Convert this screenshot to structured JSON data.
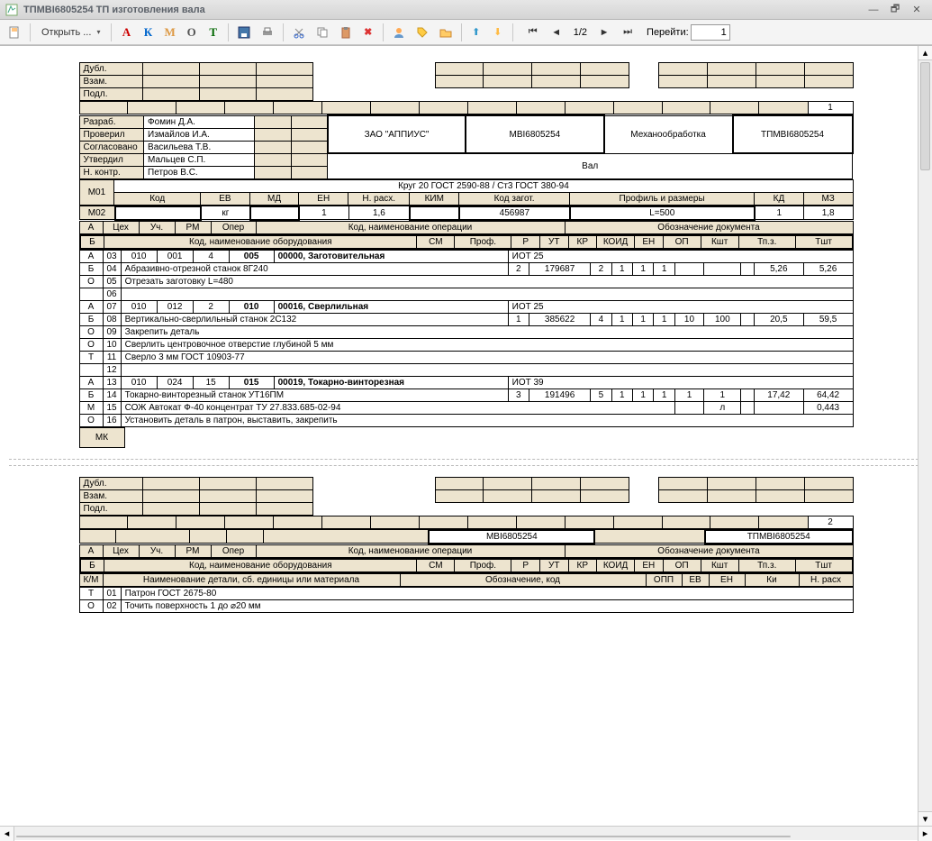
{
  "window": {
    "title": "ТПМВІ6805254 ТП изготовления вала"
  },
  "toolbar": {
    "open_label": "Открыть ...",
    "letters": [
      "А",
      "К",
      "М",
      "О",
      "Т"
    ],
    "page_indicator": "1/2",
    "goto_label": "Перейти:",
    "goto_value": "1"
  },
  "page1": {
    "stubs": [
      "Дубл.",
      "Взам.",
      "Подл."
    ],
    "page_no": "1",
    "signers": [
      {
        "role": "Разраб.",
        "name": "Фомин Д.А."
      },
      {
        "role": "Проверил",
        "name": "Измайлов И.А."
      },
      {
        "role": "Согласовано",
        "name": "Васильева Т.В."
      },
      {
        "role": "Утвердил",
        "name": "Мальцев С.П."
      },
      {
        "role": "Н. контр.",
        "name": "Петров В.С."
      }
    ],
    "company": "ЗАО \"АППИУС\"",
    "code1": "МВІ6805254",
    "proc": "Механообработка",
    "code2": "ТПМВІ6805254",
    "part_name": "Вал",
    "material": "Круг 20  ГОСТ 2590-88 / Ст3  ГОСТ 380-94",
    "m01": "М01",
    "m02": "М02",
    "hdr1": {
      "kod": "Код",
      "ev": "ЕВ",
      "md": "МД",
      "en": "ЕН",
      "nrash": "Н. расх.",
      "kim": "КИМ",
      "kodz": "Код загот.",
      "prof": "Профиль и размеры",
      "kd": "КД",
      "mz": "МЗ"
    },
    "vals1": {
      "ev": "кг",
      "en": "1",
      "nrash": "1,6",
      "kodz": "456987",
      "prof": "L=500",
      "kd": "1",
      "mz": "1,8"
    },
    "ophdr": {
      "a": "А",
      "ceh": "Цех",
      "uch": "Уч.",
      "rm": "РМ",
      "oper": "Опер",
      "opname": "Код, наименование операции",
      "doc": "Обозначение документа"
    },
    "bhdr": {
      "b": "Б",
      "equip": "Код, наименование оборудования",
      "sm": "СМ",
      "prof": "Проф.",
      "r": "Р",
      "ut": "УТ",
      "kr": "КР",
      "koid": "КОИД",
      "en": "ЕН",
      "op": "ОП",
      "ksht": "Кшт",
      "tpz": "Тп.з.",
      "tsht": "Тшт"
    },
    "rows": [
      {
        "m": "А",
        "n": "03",
        "ceh": "010",
        "uch": "001",
        "rm": "4",
        "oper": "005",
        "name": "00000, Заготовительная",
        "doc": "ИОТ 25"
      },
      {
        "m": "Б",
        "n": "04",
        "text": "Абразивно-отрезной станок 8Г240",
        "sm": "2",
        "prof": "179687",
        "r": "2",
        "ut": "1",
        "kr": "1",
        "koid": "1",
        "tpz": "5,26",
        "tsht": "5,26"
      },
      {
        "m": "О",
        "n": "05",
        "text": "Отрезать заготовку L=480"
      },
      {
        "m": "",
        "n": "06"
      },
      {
        "m": "А",
        "n": "07",
        "ceh": "010",
        "uch": "012",
        "rm": "2",
        "oper": "010",
        "name": "00016, Сверлильная",
        "doc": "ИОТ 25"
      },
      {
        "m": "Б",
        "n": "08",
        "text": "Вертикально-сверлильный станок 2С132",
        "sm": "1",
        "prof": "385622",
        "r": "4",
        "ut": "1",
        "kr": "1",
        "koid": "1",
        "en": "10",
        "op": "100",
        "tpz": "20,5",
        "tsht": "59,5"
      },
      {
        "m": "О",
        "n": "09",
        "text": "Закрепить деталь"
      },
      {
        "m": "О",
        "n": "10",
        "text": "Сверлить  центровочное отверстие  глубиной 5 мм"
      },
      {
        "m": "Т",
        "n": "11",
        "text": "Сверло 3 мм   ГОСТ 10903-77"
      },
      {
        "m": "",
        "n": "12"
      },
      {
        "m": "А",
        "n": "13",
        "ceh": "010",
        "uch": "024",
        "rm": "15",
        "oper": "015",
        "name": "00019, Токарно-винторезная",
        "doc": "ИОТ 39"
      },
      {
        "m": "Б",
        "n": "14",
        "text": "Токарно-винторезный станок УТ16ПМ",
        "sm": "3",
        "prof": "191496",
        "r": "5",
        "ut": "1",
        "kr": "1",
        "koid": "1",
        "en": "1",
        "op": "1",
        "tpz": "17,42",
        "tsht": "64,42"
      },
      {
        "m": "М",
        "n": "15",
        "text": "СОЖ Автокат Ф-40 концентрат ТУ 27.833.685-02-94",
        "op": "л",
        "tsht": "0,443"
      },
      {
        "m": "О",
        "n": "16",
        "text": "Установить деталь в патрон, выставить, закрепить"
      }
    ],
    "footer": "МК"
  },
  "page2": {
    "stubs": [
      "Дубл.",
      "Взам.",
      "Подл."
    ],
    "page_no": "2",
    "code1": "МВІ6805254",
    "code2": "ТПМВІ6805254",
    "ophdr": {
      "a": "А",
      "ceh": "Цех",
      "uch": "Уч.",
      "rm": "РМ",
      "oper": "Опер",
      "opname": "Код, наименование операции",
      "doc": "Обозначение документа"
    },
    "bhdr": {
      "b": "Б",
      "equip": "Код, наименование оборудования",
      "sm": "СМ",
      "prof": "Проф.",
      "r": "Р",
      "ut": "УТ",
      "kr": "КР",
      "koid": "КОИД",
      "en": "ЕН",
      "op": "ОП",
      "ksht": "Кшт",
      "tpz": "Тп.з.",
      "tsht": "Тшт"
    },
    "kmhdr": {
      "km": "К/М",
      "name": "Наименование детали, сб. единицы или материала",
      "obzn": "Обозначение, код",
      "opp": "ОПП",
      "ev": "ЕВ",
      "en": "ЕН",
      "ki": "Ки",
      "nr": "Н. расх"
    },
    "rows": [
      {
        "m": "Т",
        "n": "01",
        "text": "Патрон  ГОСТ 2675-80"
      },
      {
        "m": "О",
        "n": "02",
        "text": "Точить поверхность 1 до ⌀20 мм"
      }
    ]
  }
}
